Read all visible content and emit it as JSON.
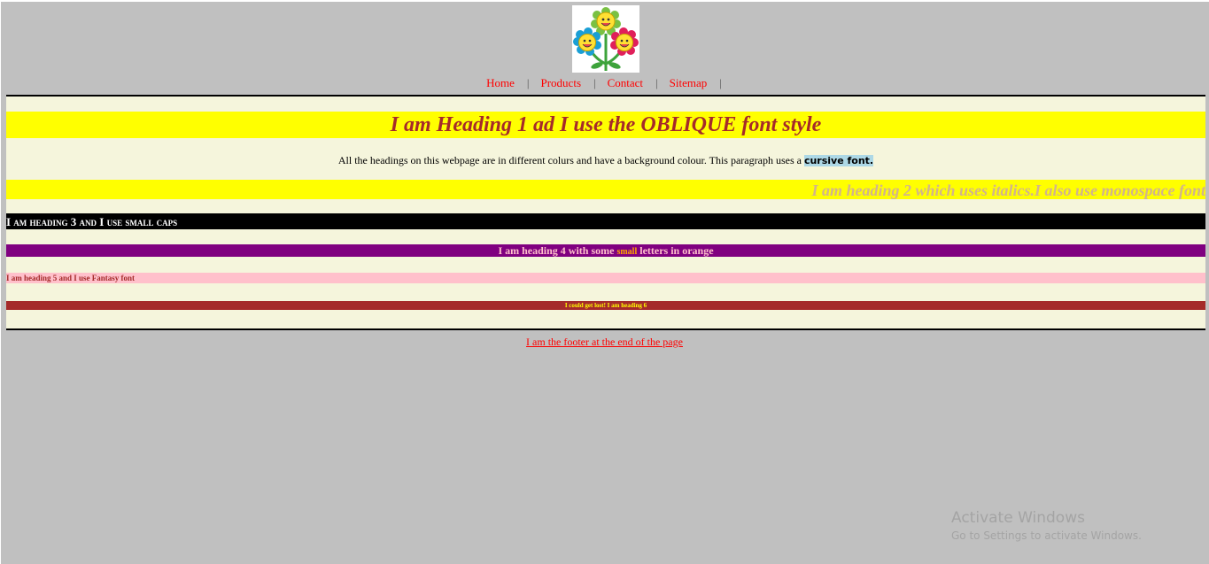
{
  "logo": {
    "icon": "flowers-logo-icon"
  },
  "nav": {
    "items": [
      {
        "label": "Home"
      },
      {
        "label": "Products"
      },
      {
        "label": "Contact"
      },
      {
        "label": "Sitemap"
      }
    ],
    "separator": "|"
  },
  "headings": {
    "h1": "I am Heading 1 ad I use the OBLIQUE font style",
    "h2": "I am heading 2 which uses italics.I also use monospace font",
    "h3": "I am heading 3 and I use small caps",
    "h4": {
      "before": "I am heading 4 with some ",
      "small": "small",
      "after": " letters in orange"
    },
    "h5": "I am heading 5 and I use Fantasy font",
    "h6": "I could get lost! I am heading 6"
  },
  "paragraph": {
    "text": "All the headings on this webpage are in different colurs and have a background colour. This paragraph uses a ",
    "highlight": "cursive font."
  },
  "footer": {
    "link": "I am the footer at the end of the page"
  },
  "watermark": {
    "title": "Activate Windows",
    "subtitle": "Go to Settings to activate Windows."
  },
  "colors": {
    "page_bg": "#c0c0c0",
    "content_bg": "#f5f5dc",
    "link": "#ff0000",
    "h1_bg": "#ffff00",
    "h1_text": "#a52a2a",
    "h2_bg": "#ffff00",
    "h2_text": "#d2b48c",
    "h3_bg": "#000000",
    "h3_text": "#ffffff",
    "h4_bg": "#800080",
    "h4_text": "#ffc0cb",
    "h4_small": "#ffa500",
    "h5_bg": "#ffc0cb",
    "h5_text": "#a52a2a",
    "h6_bg": "#a52a2a",
    "h6_text": "#ffff00",
    "highlight_bg": "#add8e6"
  }
}
